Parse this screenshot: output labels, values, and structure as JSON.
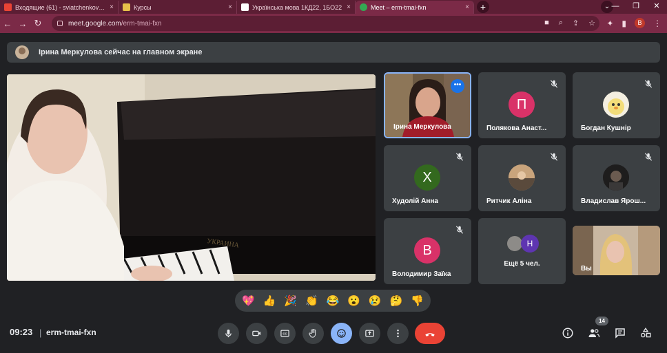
{
  "browser": {
    "tabs": [
      {
        "label": "Входящие (61) - sviatchenkovv@",
        "icon_color": "#ea4335",
        "active": false
      },
      {
        "label": "Курсы",
        "icon_color": "#e7c04a",
        "active": false
      },
      {
        "label": "Українська мова 1КД22, 1БО22",
        "icon_color": "#ffffff",
        "active": false
      },
      {
        "label": "Meet – erm-tmai-fxn",
        "icon_color": "#34a853",
        "active": true
      }
    ],
    "url_host": "meet.google.com",
    "url_path": "/erm-tmai-fxn",
    "profile_letter": "B",
    "new_tab": "+",
    "close": "×"
  },
  "banner": {
    "text": "Ірина Меркулова сейчас на главном экране"
  },
  "tiles": [
    {
      "name": "Ірина Меркулова",
      "type": "video",
      "active": true
    },
    {
      "name": "Полякова Анаст...",
      "type": "avatar",
      "letter": "П",
      "color": "#d93268"
    },
    {
      "name": "Богдан Кушнір",
      "type": "photo",
      "color": "#f4efe1"
    },
    {
      "name": "Худолій Анна",
      "type": "avatar",
      "letter": "Х",
      "color": "#33691e"
    },
    {
      "name": "Ритчик Аліна",
      "type": "photo",
      "color": "#a28567"
    },
    {
      "name": "Владислав Ярош...",
      "type": "photo",
      "color": "#2c2b2b"
    },
    {
      "name": "Володимир Заїка",
      "type": "avatar",
      "letter": "В",
      "color": "#d93268"
    },
    {
      "name": "Ещё 5 чел.",
      "type": "more",
      "letter": "Н",
      "color": "#5e35b1"
    },
    {
      "name": "Вы",
      "type": "self"
    }
  ],
  "reactions": [
    "💖",
    "👍",
    "🎉",
    "👏",
    "😂",
    "😮",
    "😢",
    "🤔",
    "👎"
  ],
  "footer": {
    "time": "09:23",
    "separator": "|",
    "meeting_code": "erm-tmai-fxn",
    "participants_count": "14"
  }
}
